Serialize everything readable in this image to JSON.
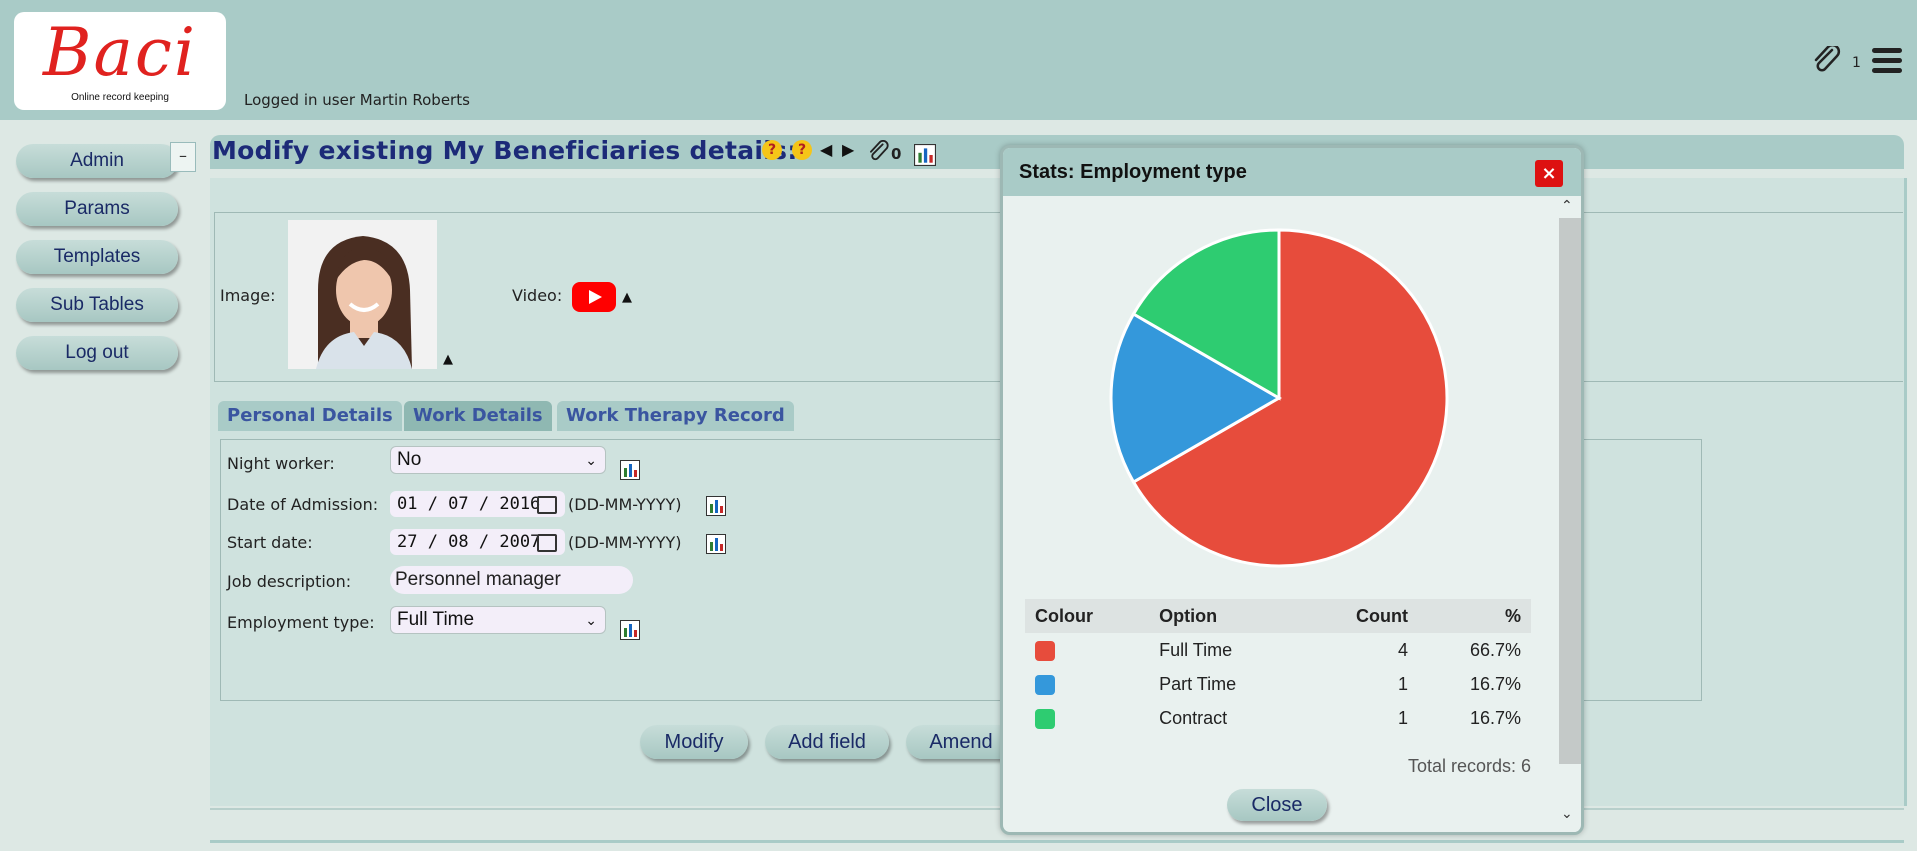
{
  "header": {
    "logo_text": "Baci",
    "logo_tagline": "Online record keeping",
    "logged_in": "Logged in user Martin Roberts",
    "attachment_count": "1",
    "icons": [
      "paperclip-icon",
      "hamburger-menu-icon"
    ]
  },
  "sidebar": {
    "items": [
      {
        "label": "Admin"
      },
      {
        "label": "Params"
      },
      {
        "label": "Templates"
      },
      {
        "label": "Sub Tables"
      },
      {
        "label": "Log out"
      }
    ],
    "collapse_label": "–"
  },
  "main": {
    "title": "Modify existing My Beneficiaries details:",
    "help_glyph": "?",
    "attachment_count": "0",
    "image_label": "Image:",
    "video_label": "Video:",
    "tabs": [
      {
        "label": "Personal Details"
      },
      {
        "label": "Work Details",
        "active": true
      },
      {
        "label": "Work Therapy Record"
      }
    ],
    "fields": {
      "night_worker": {
        "label": "Night worker:",
        "value": "No"
      },
      "date_of_admission": {
        "label": "Date of Admission:",
        "value": "01 / 07 / 2016",
        "format": "(DD-MM-YYYY)"
      },
      "start_date": {
        "label": "Start date:",
        "value": "27 / 08 / 2007",
        "format": "(DD-MM-YYYY)"
      },
      "job_description": {
        "label": "Job description:",
        "value": "Personnel manager"
      },
      "employment_type": {
        "label": "Employment type:",
        "value": "Full Time"
      }
    },
    "actions": [
      {
        "label": "Modify"
      },
      {
        "label": "Add field"
      },
      {
        "label": "Amend"
      }
    ]
  },
  "modal": {
    "title": "Stats: Employment type",
    "close_x": "×",
    "close_label": "Close",
    "total": "Total records: 6",
    "columns": [
      "Colour",
      "Option",
      "Count",
      "%"
    ],
    "rows": [
      {
        "option": "Full Time",
        "count": "4",
        "pct": "66.7%",
        "color": "#e74c3c"
      },
      {
        "option": "Part Time",
        "count": "1",
        "pct": "16.7%",
        "color": "#3498db"
      },
      {
        "option": "Contract",
        "count": "1",
        "pct": "16.7%",
        "color": "#2ecc71"
      }
    ]
  },
  "chart_data": {
    "type": "pie",
    "categories": [
      "Full Time",
      "Part Time",
      "Contract"
    ],
    "values": [
      4,
      1,
      1
    ],
    "colors": [
      "#e74c3c",
      "#3498db",
      "#2ecc71"
    ]
  },
  "colors": {
    "accent": "#a9cbc7",
    "title_text": "#1c2a78",
    "button_text": "#1a2a66"
  }
}
